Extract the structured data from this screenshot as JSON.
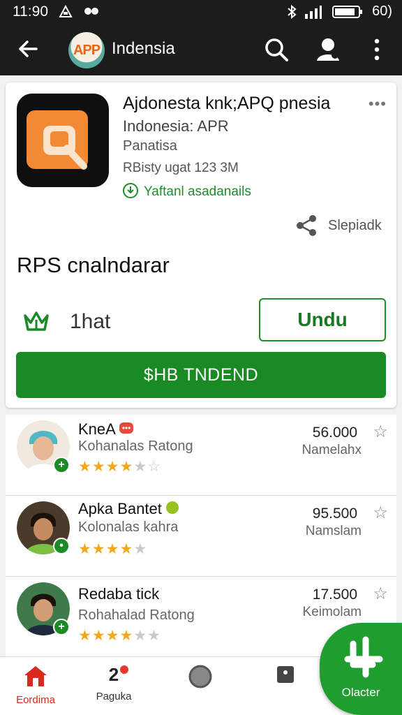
{
  "status_bar": {
    "time": "11:90",
    "right_text": "60)"
  },
  "app_bar": {
    "logo_text": "APP",
    "title": "Indensia"
  },
  "app": {
    "name": "Ajdonesta knk;APQ pnesia",
    "developer": "Indonesia: APR",
    "category": "Panatisa",
    "meta": "RBisty ugat 123 3M",
    "installed_label": "Yaftanl asadanails",
    "share_label": "Slepiadk"
  },
  "section": {
    "title": "RPS cnalndarar"
  },
  "rating": {
    "text": "1hat",
    "action_label": "Undu"
  },
  "primary_action": {
    "label": "$HB TNDEND"
  },
  "list": [
    {
      "name": "KneA",
      "pill": "•••",
      "subtitle": "Kohanalas Ratong",
      "rating": 4,
      "price": "56.000",
      "unit": "Namelahx",
      "badge": "+"
    },
    {
      "name": "Apka Bantet",
      "subtitle": "Kolonalas kahra",
      "rating": 4,
      "price": "95.500",
      "unit": "Namslam",
      "badge": "•"
    },
    {
      "name": "Redaba tick",
      "subtitle": "Rohahalad Ratong",
      "rating": 4,
      "price": "17.500",
      "unit": "Keimolam",
      "badge": "+"
    }
  ],
  "bottom_nav": [
    {
      "label": "Eordima"
    },
    {
      "label": "Paguka",
      "icon_text": "2"
    },
    {
      "label": ""
    },
    {
      "label": ""
    }
  ],
  "fab": {
    "label": "Olacter"
  },
  "colors": {
    "accent": "#1a8a24",
    "appbar": "#1c1c1c",
    "home_red": "#d9281c"
  }
}
